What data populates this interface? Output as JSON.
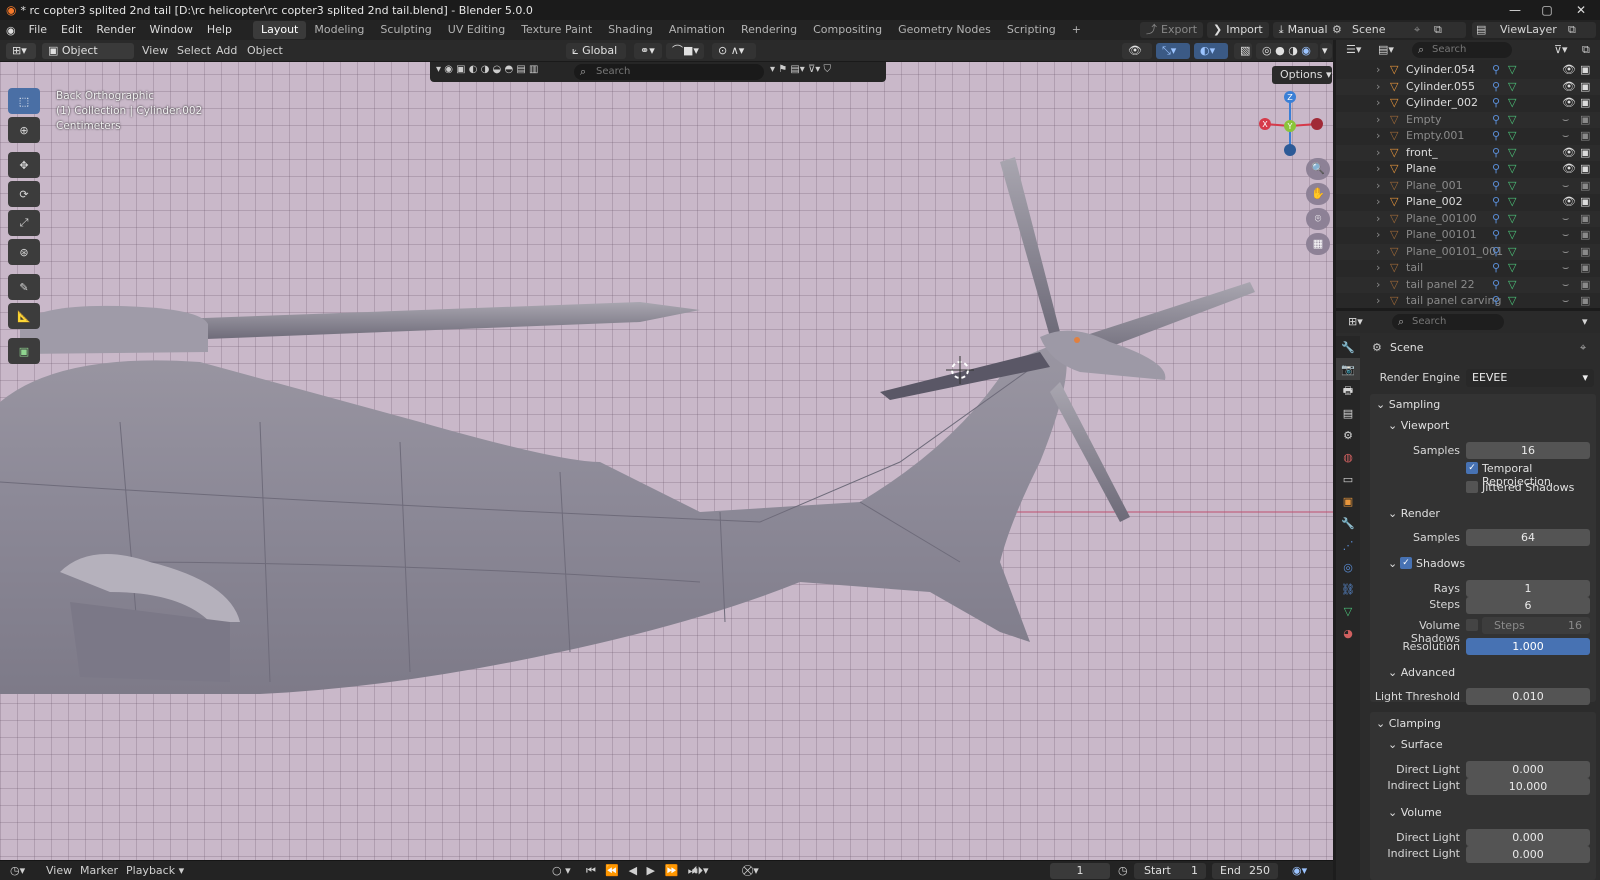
{
  "window": {
    "title": "* rc copter3 splited 2nd tail [D:\\rc helicopter\\rc copter3 splited 2nd tail.blend] - Blender 5.0.0",
    "controls": [
      "—",
      "▢",
      "✕"
    ]
  },
  "menu": [
    "File",
    "Edit",
    "Render",
    "Window",
    "Help"
  ],
  "workspaces": [
    {
      "label": "Layout",
      "active": true
    },
    {
      "label": "Modeling"
    },
    {
      "label": "Sculpting"
    },
    {
      "label": "UV Editing"
    },
    {
      "label": "Texture Paint"
    },
    {
      "label": "Shading"
    },
    {
      "label": "Animation"
    },
    {
      "label": "Rendering"
    },
    {
      "label": "Compositing"
    },
    {
      "label": "Geometry Nodes"
    },
    {
      "label": "Scripting"
    }
  ],
  "topright": {
    "export": "Export",
    "import": "Import",
    "manual": "Manual",
    "scene": "Scene",
    "view_layer": "ViewLayer"
  },
  "viewport_header": {
    "mode": "Object Mode",
    "menus": [
      "View",
      "Select",
      "Add",
      "Object"
    ],
    "transform_orientation": "Global",
    "search_placeholder": "Search",
    "options": "Options"
  },
  "viewport_overlay": {
    "view_name": "Back Orthographic",
    "collection": "(1) Collection | Cylinder.002",
    "units": "Centimeters"
  },
  "gizmo": {
    "z": "Z",
    "y": "Y",
    "x": "X"
  },
  "timeline": {
    "menus": [
      "View",
      "Marker",
      "Playback"
    ],
    "current_frame": "1",
    "start_label": "Start",
    "start": "1",
    "end_label": "End",
    "end": "250"
  },
  "outliner": {
    "search_placeholder": "Search",
    "items": [
      {
        "name": "Cylinder.054",
        "visible": true
      },
      {
        "name": "Cylinder.055",
        "visible": true
      },
      {
        "name": "Cylinder_002",
        "visible": true
      },
      {
        "name": "Empty",
        "visible": false
      },
      {
        "name": "Empty.001",
        "visible": false
      },
      {
        "name": "front_",
        "visible": true
      },
      {
        "name": "Plane",
        "visible": true
      },
      {
        "name": "Plane_001",
        "visible": false
      },
      {
        "name": "Plane_002",
        "visible": true
      },
      {
        "name": "Plane_00100",
        "visible": false
      },
      {
        "name": "Plane_00101",
        "visible": false
      },
      {
        "name": "Plane_00101_001",
        "visible": false
      },
      {
        "name": "tail",
        "visible": false
      },
      {
        "name": "tail panel 22",
        "visible": false
      },
      {
        "name": "tail panel carving",
        "visible": false
      }
    ]
  },
  "properties": {
    "search_placeholder": "Search",
    "context": "Scene",
    "render_engine_label": "Render Engine",
    "render_engine": "EEVEE",
    "sampling": "Sampling",
    "viewport": "Viewport",
    "samples_label": "Samples",
    "viewport_samples": "16",
    "temporal_reprojection": "Temporal Reprojection",
    "jittered_shadows": "Jittered Shadows",
    "render": "Render",
    "render_samples": "64",
    "shadows": "Shadows",
    "rays_label": "Rays",
    "rays": "1",
    "steps_label": "Steps",
    "steps": "6",
    "volume_shadows_label": "Volume Shadows",
    "volume_steps_label": "Steps",
    "volume_steps": "16",
    "resolution_label": "Resolution",
    "resolution": "1.000",
    "advanced": "Advanced",
    "light_threshold_label": "Light Threshold",
    "light_threshold": "0.010",
    "clamping": "Clamping",
    "surface": "Surface",
    "direct_light_label": "Direct Light",
    "surface_direct": "0.000",
    "indirect_light_label": "Indirect Light",
    "surface_indirect": "10.000",
    "volume": "Volume",
    "volume_direct": "0.000",
    "volume_indirect": "0.000"
  },
  "colors": {
    "accent": "#4772b3",
    "viewport_bg": "#c9b8c9",
    "model": "#8a8a96",
    "axis_x": "#d63a4a",
    "axis_y": "#8ac43a",
    "axis_z": "#3a7fd6"
  }
}
